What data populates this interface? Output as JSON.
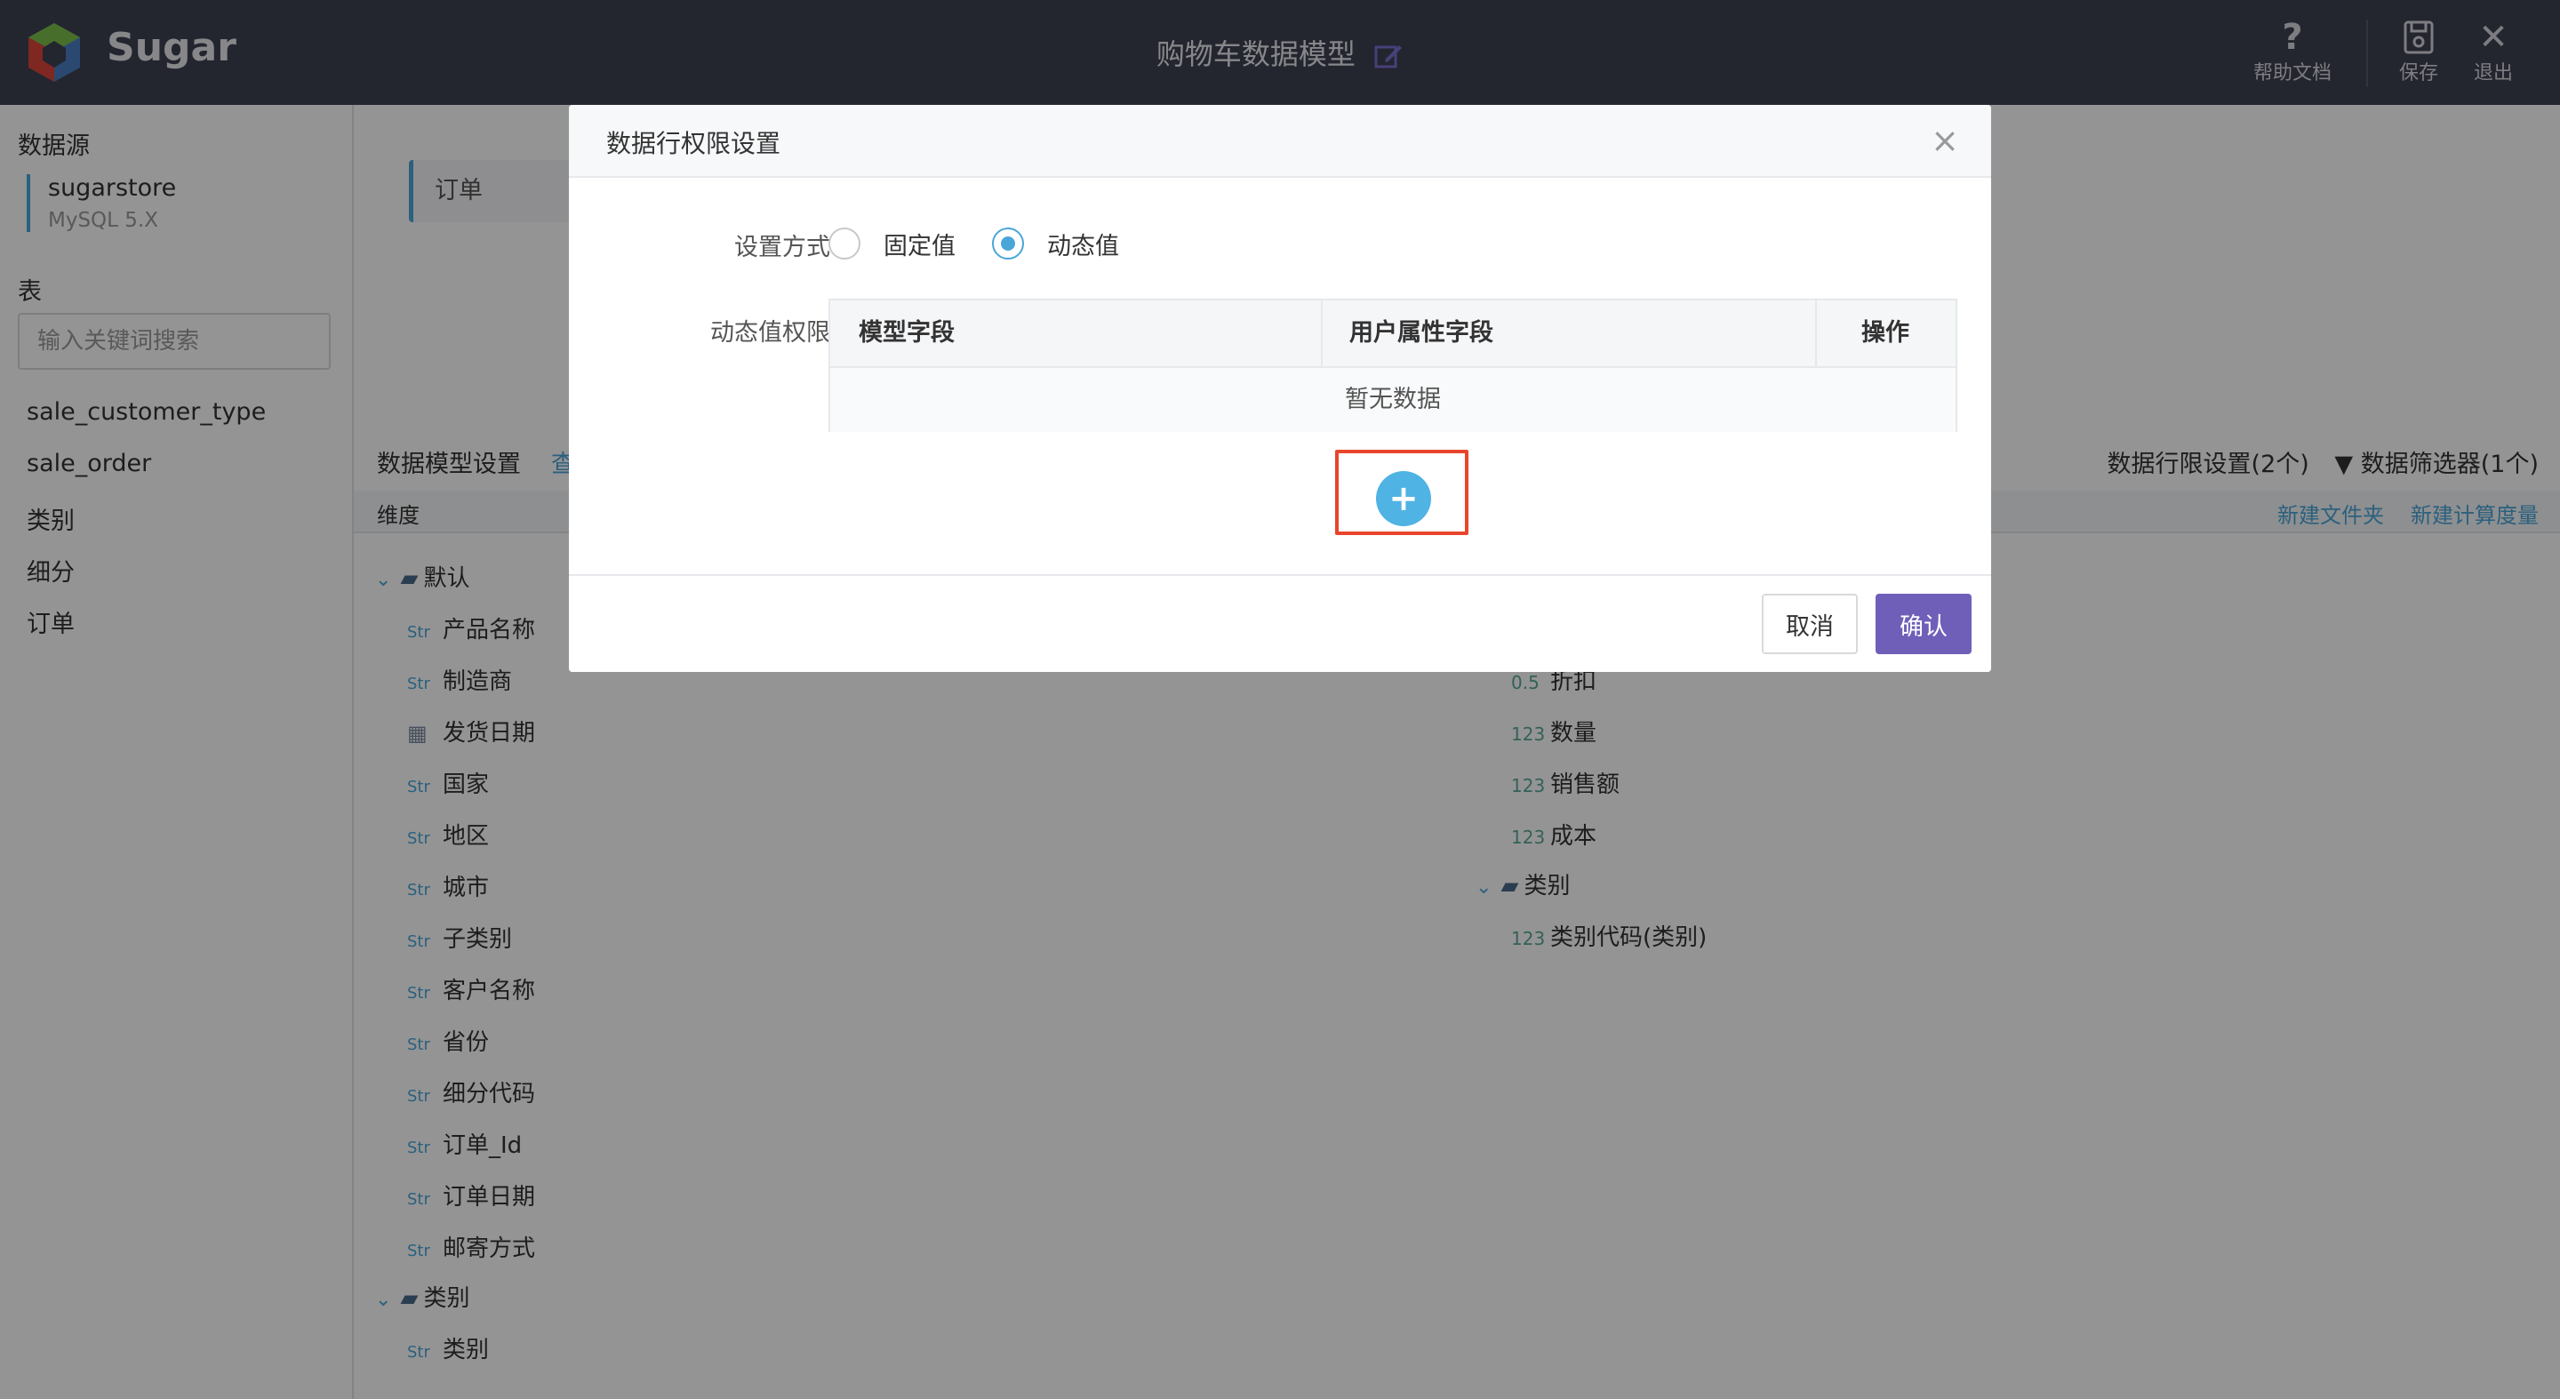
{
  "header": {
    "brand": "Sugar",
    "model_title": "购物车数据模型",
    "help_label": "帮助文档",
    "save_label": "保存",
    "exit_label": "退出"
  },
  "sidebar": {
    "datasource_label": "数据源",
    "datasource_name": "sugarstore",
    "datasource_version": "MySQL 5.X",
    "table_label": "表",
    "search_placeholder": "输入关键词搜索",
    "tables": [
      "sale_customer_type",
      "sale_order",
      "类别",
      "细分",
      "订单"
    ]
  },
  "main": {
    "order_tab": "订单",
    "section_title": "数据模型设置",
    "section_link": "查",
    "rls_summary": "数据行限设置(2个)",
    "filter_summary": "数据筛选器(1个)",
    "dimension_header": "维度",
    "new_folder": "新建文件夹",
    "new_measure": "新建计算度量",
    "dimension_folders": [
      {
        "name": "默认",
        "fields": [
          "产品名称",
          "制造商",
          "发货日期",
          "国家",
          "地区",
          "城市",
          "子类别",
          "客户名称",
          "省份",
          "细分代码",
          "订单_Id",
          "订单日期",
          "邮寄方式"
        ]
      },
      {
        "name": "类别",
        "fields": [
          "类别"
        ]
      }
    ],
    "measure_fields": [
      "折扣",
      "数量",
      "销售额",
      "成本"
    ],
    "measure_folder": {
      "name": "类别",
      "fields": [
        "类别代码(类别)"
      ]
    },
    "type_str": "Str",
    "type_num": "123",
    "type_dec": "0.5"
  },
  "modal": {
    "title": "数据行权限设置",
    "close_glyph": "×",
    "mode_label": "设置方式",
    "option_fixed": "固定值",
    "option_dynamic": "动态值",
    "selected_option": "动态值",
    "dynamic_label": "动态值权限",
    "table_headers": [
      "模型字段",
      "用户属性字段",
      "操作"
    ],
    "empty_text": "暂无数据",
    "add_glyph": "+",
    "cancel_label": "取消",
    "confirm_label": "确认"
  },
  "colors": {
    "header_bg": "#3d4052",
    "accent": "#4aa6d9",
    "primary_button": "#6f5fb8",
    "highlight_box": "#e8452c"
  }
}
